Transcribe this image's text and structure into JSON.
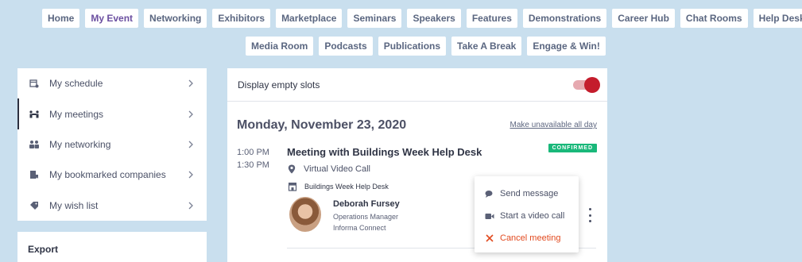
{
  "nav": {
    "row1": [
      "Home",
      "My Event",
      "Networking",
      "Exhibitors",
      "Marketplace",
      "Seminars",
      "Speakers",
      "Features",
      "Demonstrations",
      "Career Hub",
      "Chat Rooms",
      "Help Desk"
    ],
    "row2": [
      "Media Room",
      "Podcasts",
      "Publications",
      "Take A Break",
      "Engage & Win!"
    ],
    "active": "My Event"
  },
  "sidebar": {
    "items": [
      {
        "label": "My schedule",
        "icon": "schedule-icon"
      },
      {
        "label": "My meetings",
        "icon": "meetings-icon"
      },
      {
        "label": "My networking",
        "icon": "networking-icon"
      },
      {
        "label": "My bookmarked companies",
        "icon": "bookmark-icon"
      },
      {
        "label": "My wish list",
        "icon": "wishlist-icon"
      }
    ],
    "active_index": 1
  },
  "export": {
    "title": "Export"
  },
  "panel": {
    "display_empty_slots_label": "Display empty slots",
    "display_empty_slots_on": true,
    "day_title": "Monday, November 23, 2020",
    "make_unavailable": "Make unavailable all day",
    "meeting": {
      "start": "1:00 PM",
      "end": "1:30 PM",
      "title": "Meeting with Buildings Week Help Desk",
      "status": "CONFIRMED",
      "location": "Virtual Video Call",
      "organization": "Buildings Week Help Desk",
      "person": {
        "name": "Deborah Fursey",
        "role": "Operations Manager",
        "company": "Informa Connect"
      }
    }
  },
  "menu": {
    "items": [
      {
        "label": "Send message",
        "icon": "chat-icon"
      },
      {
        "label": "Start a video call",
        "icon": "video-icon"
      },
      {
        "label": "Cancel meeting",
        "icon": "close-icon"
      }
    ]
  },
  "colors": {
    "background": "#c9dfee",
    "accent": "#6b4fa0",
    "toggle": "#c41c2c",
    "confirmed": "#19b87a",
    "danger": "#e24a1f"
  }
}
